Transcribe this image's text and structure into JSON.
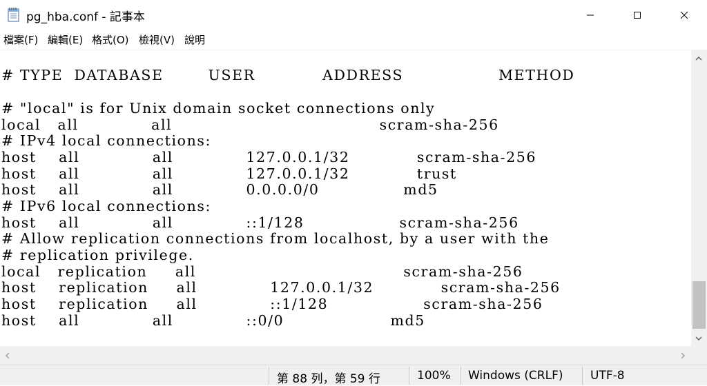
{
  "window": {
    "title": "pg_hba.conf - 記事本",
    "minimize_glyph": "—",
    "maximize_glyph": "☐",
    "close_glyph": "✕"
  },
  "menu": [
    "檔案(F)",
    "編輯(E)",
    "格式(O)",
    "檢視(V)",
    "說明"
  ],
  "editor": {
    "lines": [
      "# TYPE  DATABASE        USER            ADDRESS                 METHOD",
      "",
      "# \"local\" is for Unix domain socket connections only",
      "local   all             all                                     scram-sha-256",
      "# IPv4 local connections:",
      "host    all             all             127.0.0.1/32            scram-sha-256",
      "host    all             all             127.0.0.1/32            trust",
      "host    all             all             0.0.0.0/0               md5",
      "# IPv6 local connections:",
      "host    all             all             ::1/128                 scram-sha-256",
      "# Allow replication connections from localhost, by a user with the",
      "# replication privilege.",
      "local   replication     all                                     scram-sha-256",
      "host    replication     all             127.0.0.1/32            scram-sha-256",
      "host    replication     all             ::1/128                 scram-sha-256",
      "host    all             all             ::0/0                   md5"
    ]
  },
  "status": {
    "position": "第 88 列，第 59 行",
    "zoom": "100%",
    "line_ending": "Windows (CRLF)",
    "encoding": "UTF-8"
  }
}
